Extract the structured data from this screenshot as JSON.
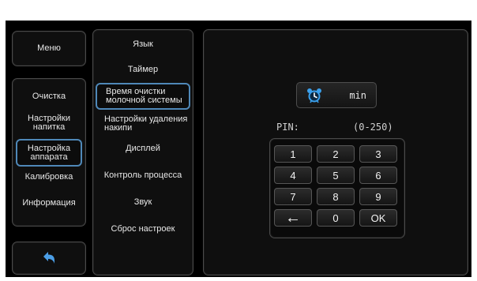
{
  "left_menu": {
    "menu_label": "Меню",
    "items": [
      {
        "label": "Очистка"
      },
      {
        "label": "Настройки напитка",
        "lines": [
          "Настройки",
          "напитка"
        ]
      },
      {
        "label": "Настройка аппарата",
        "lines": [
          "Настройка",
          "аппарата"
        ],
        "selected": true
      },
      {
        "label": "Калибровка"
      },
      {
        "label": "Информация"
      }
    ],
    "back_icon": "back-arrow-icon"
  },
  "sub_menu": {
    "items": [
      {
        "label": "Язык"
      },
      {
        "label": "Таймер"
      },
      {
        "label": "Время очистки молочной системы",
        "lines": [
          "Время очистки",
          "молочной системы"
        ],
        "selected": true
      },
      {
        "label": "Настройки удаления накипи",
        "lines": [
          "Настройки удаления",
          "накипи"
        ]
      },
      {
        "label": "Дисплей"
      },
      {
        "label": "Контроль процесса"
      },
      {
        "label": "Звук"
      },
      {
        "label": "Сброс настроек"
      }
    ]
  },
  "editor": {
    "icon": "alarm-clock-icon",
    "unit": "min",
    "pin_label": "PIN:",
    "range": "(0-250)",
    "keypad": [
      "1",
      "2",
      "3",
      "4",
      "5",
      "6",
      "7",
      "8",
      "9",
      "←",
      "0",
      "OK"
    ]
  },
  "colors": {
    "selection_border": "#4f88b8",
    "icon_blue": "#3aa0ec",
    "background": "#000000"
  }
}
